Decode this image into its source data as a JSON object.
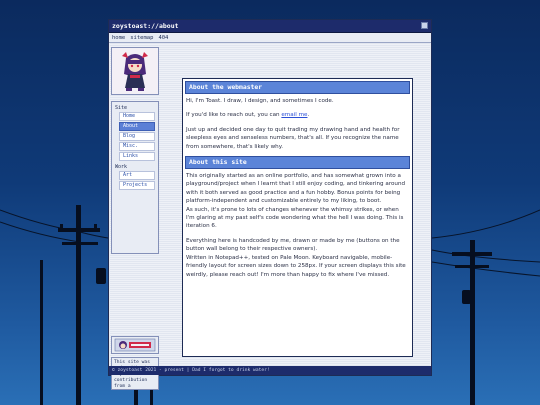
{
  "window": {
    "title": "zoystoast://about"
  },
  "menu": {
    "items": [
      "home",
      "sitemap",
      "404"
    ]
  },
  "nav": {
    "site_label": "Site",
    "site_items": [
      "Home",
      "About",
      "Blog",
      "Misc.",
      "Links"
    ],
    "work_label": "Work",
    "work_items": [
      "Art",
      "Projects"
    ],
    "active": "About"
  },
  "sidebar_note": "This site was made without any contribution from a Generative AI.",
  "about_webmaster": {
    "heading": "About the webmaster",
    "intro": "Hi, I'm Toast. I draw, I design, and sometimes I code.",
    "contact_before": "If you'd like to reach out, you can ",
    "contact_link": "email me",
    "contact_after": ".",
    "bio": "Just up and decided one day to quit trading my drawing hand and health for sleepless eyes and senseless numbers, that's all. If you recognize the name from somewhere, that's likely why."
  },
  "about_site": {
    "heading": "About this site",
    "p1": "This originally started as an online portfolio, and has somewhat grown into a playground/project when I learnt that I still enjoy coding, and tinkering around with it both served as good practice and a fun hobby. Bonus points for being platform-independent and customizable entirely to my liking, to boot.",
    "p2": "As such, it's prone to lots of changes whenever the whimsy strikes, or when I'm glaring at my past self's code wondering what the hell I was doing. This is iteration 6.",
    "p3": "Everything here is handcoded by me, drawn or made by me (buttons on the button wall belong to their respective owners).",
    "p4": "Written in Notepad++, tested on Pale Moon. Keyboard navigable, mobile-friendly layout for screen sizes down to 258px. If your screen displays this site weirdly, please reach out! I'm more than happy to fix where I've missed."
  },
  "statusbar": {
    "text": "© zoystoast 2021 - present | Dad I forgot to drink water!"
  },
  "colors": {
    "accent": "#5b84d8",
    "titlebar": "#1d2b6b",
    "link": "#2a4fd6"
  }
}
